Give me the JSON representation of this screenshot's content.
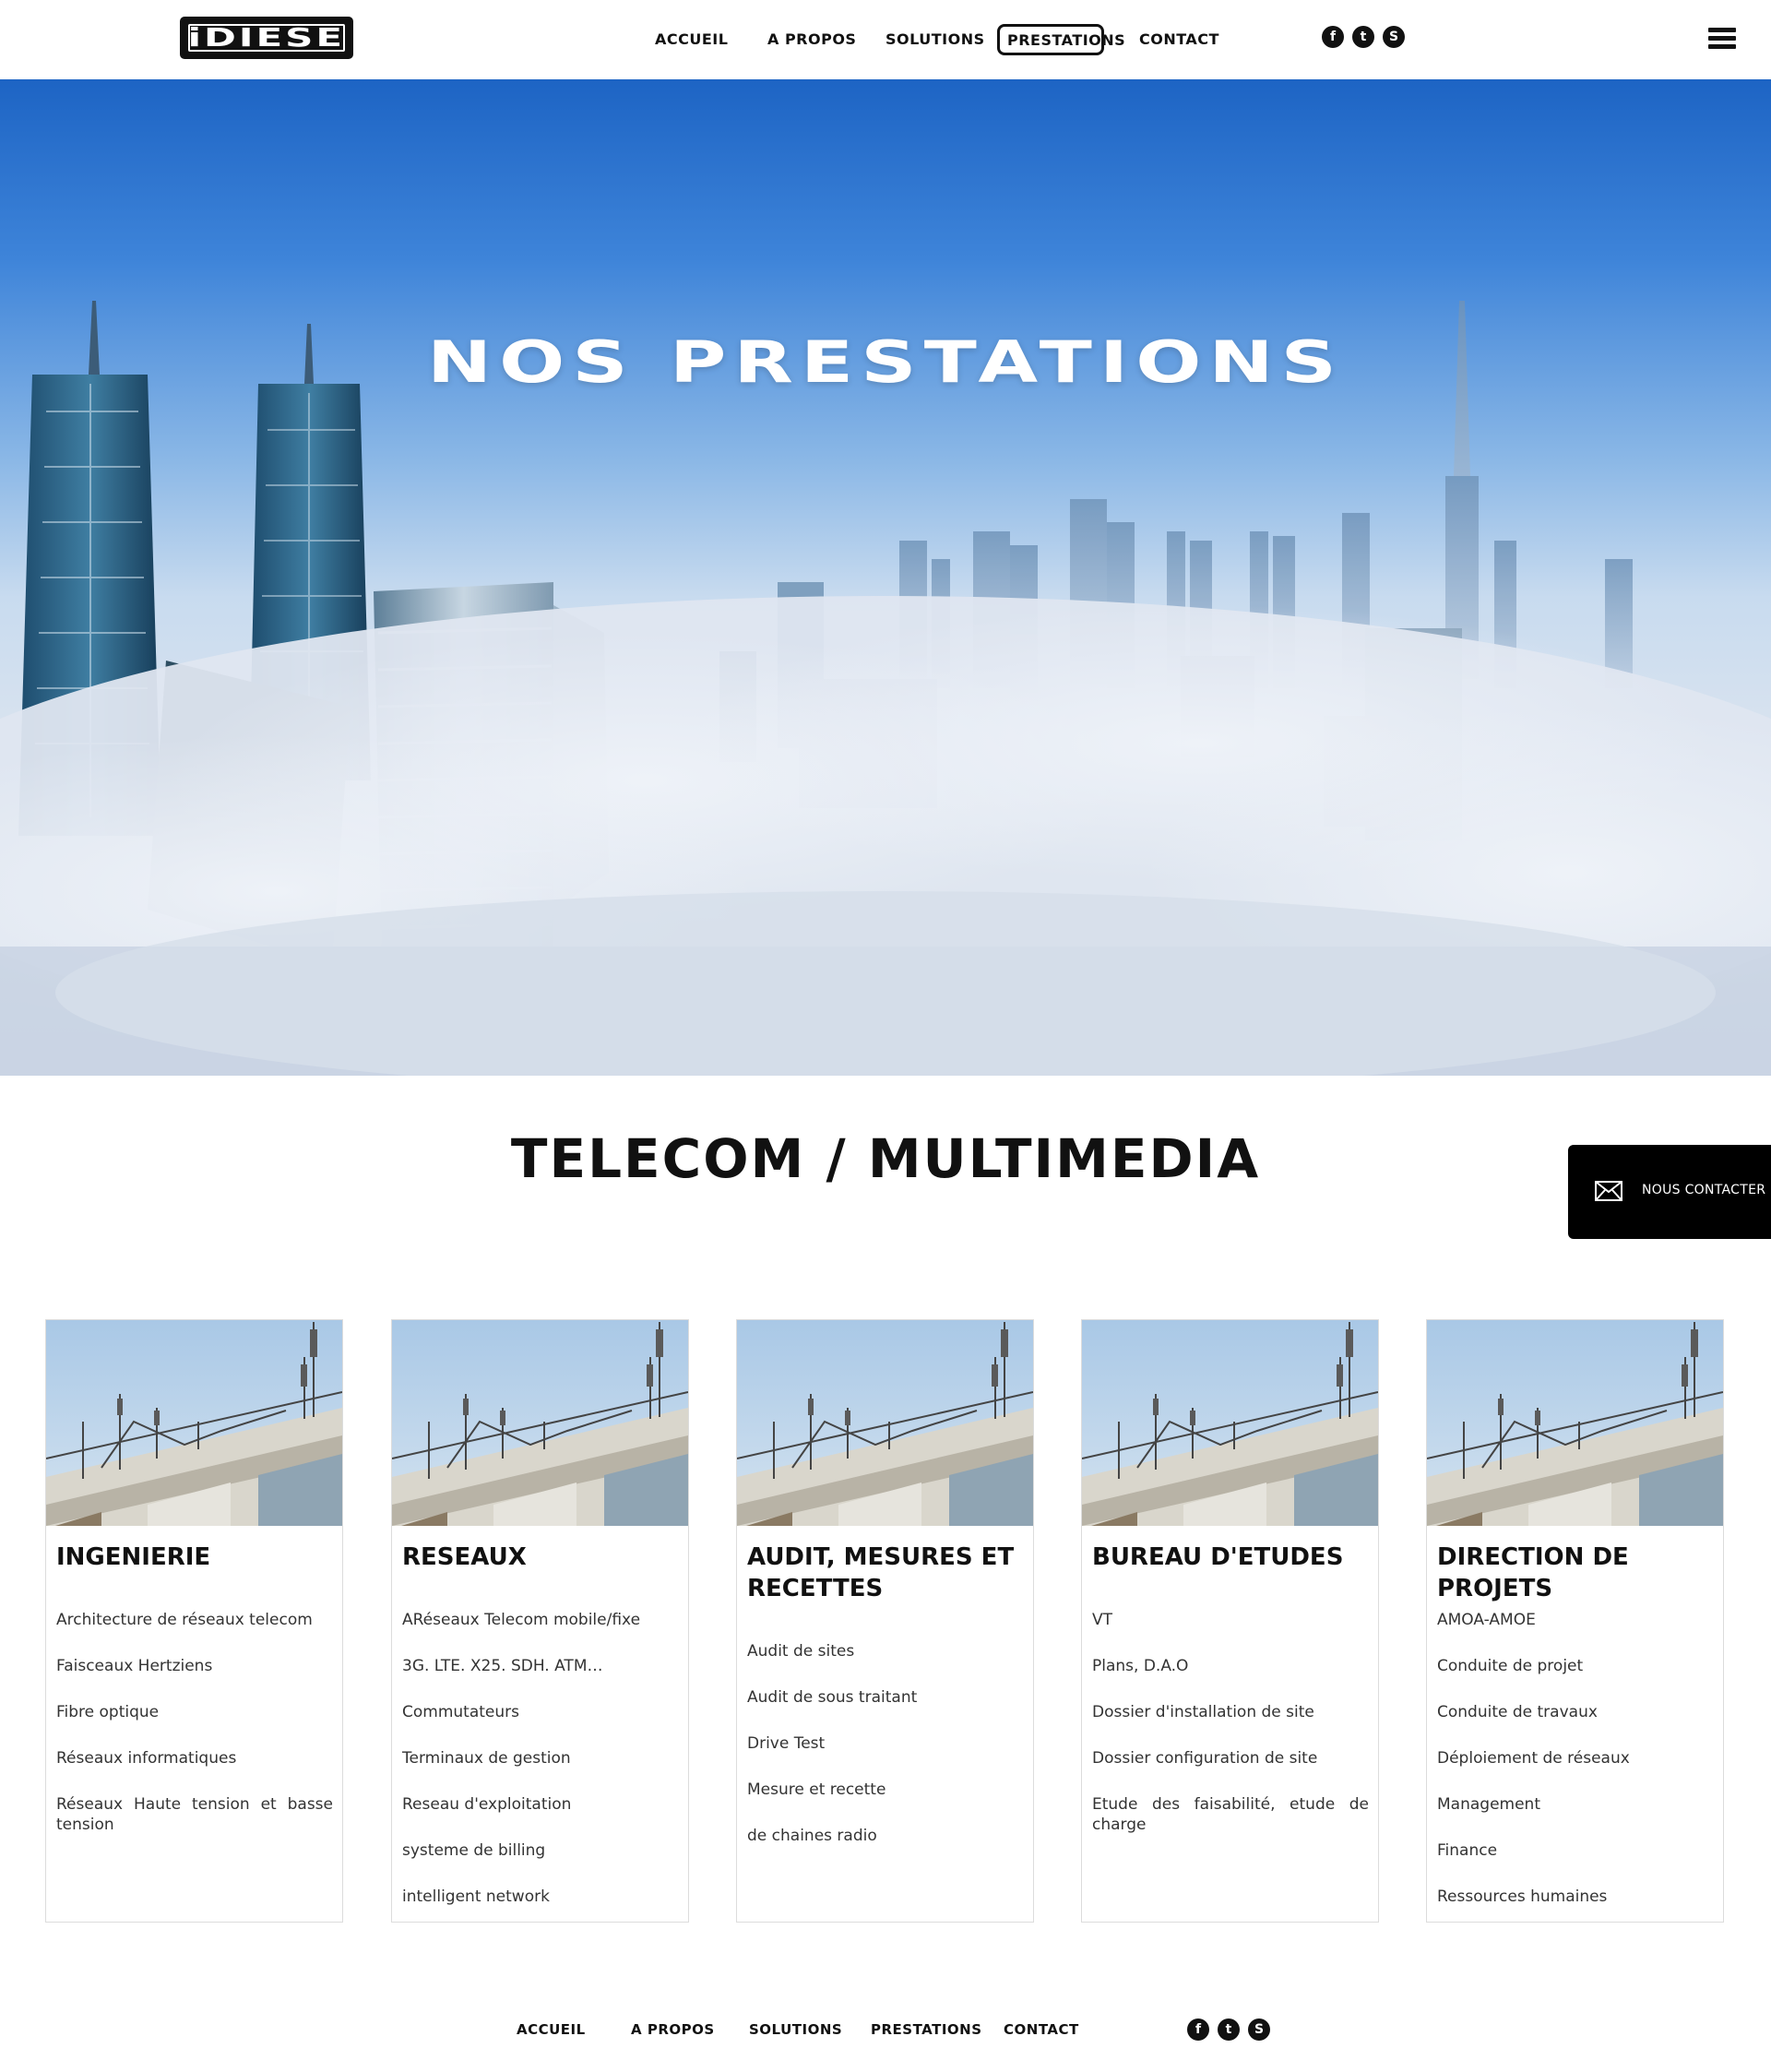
{
  "header": {
    "logo_text": "iDIESE",
    "nav": [
      {
        "label": "ACCUEIL"
      },
      {
        "label": "A PROPOS"
      },
      {
        "label": "SOLUTIONS"
      },
      {
        "label": "PRESTATIONS",
        "active": true
      },
      {
        "label": "CONTACT"
      }
    ],
    "social": [
      {
        "name": "facebook-icon",
        "glyph": "f"
      },
      {
        "name": "twitter-icon",
        "glyph": "t"
      },
      {
        "name": "skype-icon",
        "glyph": "S"
      }
    ],
    "menu_icon": "hamburger-icon"
  },
  "hero": {
    "title": "NOS PRESTATIONS"
  },
  "section": {
    "title": "TELECOM / MULTIMEDIA"
  },
  "contact_tab": {
    "label": "NOUS CONTACTER",
    "icon": "envelope-icon"
  },
  "cards": [
    {
      "title": "INGENIERIE",
      "items": [
        "Architecture de réseaux telecom",
        "Faisceaux Hertziens",
        "Fibre optique",
        "Réseaux informatiques",
        "Réseaux Haute tension et basse tension"
      ]
    },
    {
      "title": "RESEAUX",
      "items": [
        "ARéseaux Telecom mobile/fixe",
        "3G. LTE. X25. SDH. ATM…",
        "Commutateurs",
        "Terminaux de gestion",
        "Reseau d'exploitation",
        "systeme de billing",
        "intelligent network"
      ]
    },
    {
      "title": "AUDIT, MESURES ET RECETTES",
      "items": [
        "Audit de sites",
        "Audit de sous traitant",
        "Drive Test",
        "Mesure et recette",
        "de chaines radio"
      ]
    },
    {
      "title": "BUREAU D'ETUDES",
      "items": [
        "VT",
        "Plans, D.A.O",
        "Dossier d'installation de site",
        "Dossier configuration de site",
        "Etude des faisabilité, etude de charge"
      ]
    },
    {
      "title": "DIRECTION DE PROJETS",
      "items": [
        "AMOA-AMOE",
        "Conduite de projet",
        "Conduite de travaux",
        "Déploiement de réseaux",
        "Management",
        "Finance",
        "Ressources humaines"
      ]
    }
  ],
  "footer": {
    "nav": [
      {
        "label": "ACCUEIL"
      },
      {
        "label": "A PROPOS"
      },
      {
        "label": "SOLUTIONS"
      },
      {
        "label": "PRESTATIONS"
      },
      {
        "label": "CONTACT"
      }
    ],
    "social": [
      {
        "name": "facebook-icon",
        "glyph": "f"
      },
      {
        "name": "twitter-icon",
        "glyph": "t"
      },
      {
        "name": "skype-icon",
        "glyph": "S"
      }
    ]
  },
  "colors": {
    "text": "#111111",
    "background": "#ffffff",
    "card_border": "#dcdcdc",
    "contact_tab": "#000000",
    "sky_top": "#1d64c4",
    "fog": "#d9e3ef"
  }
}
